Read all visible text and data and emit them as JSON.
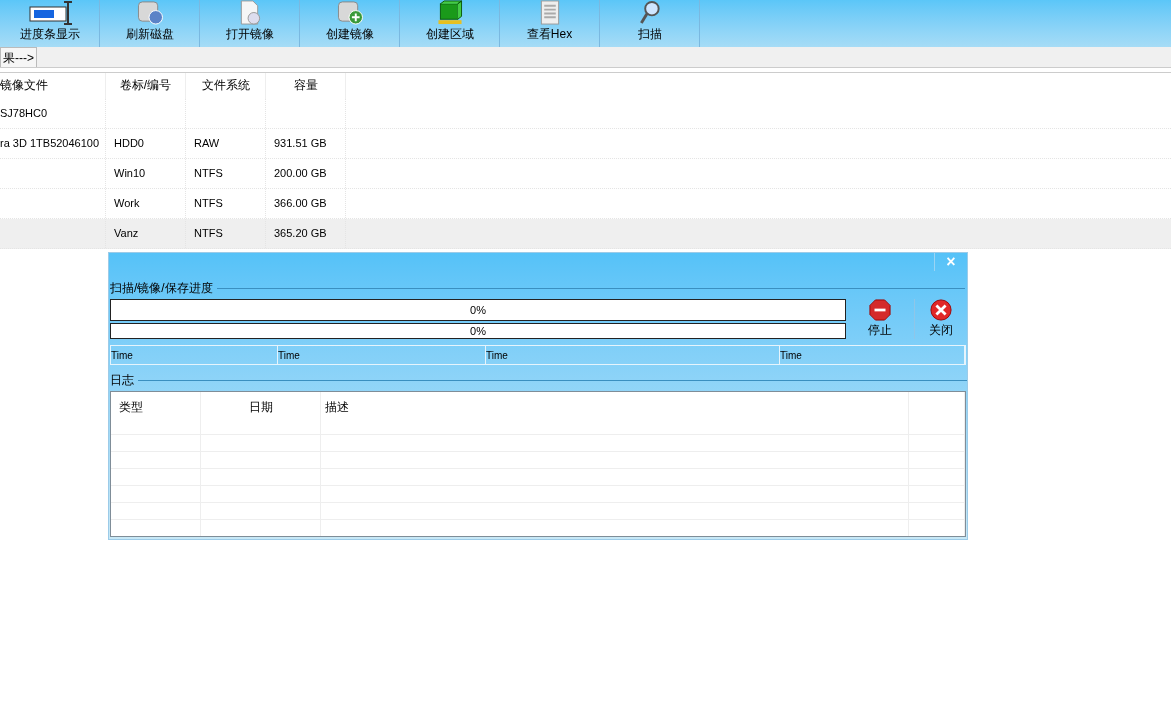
{
  "toolbar": [
    {
      "label": "进度条显示",
      "kind": "progress"
    },
    {
      "label": "刷新磁盘",
      "kind": "refresh"
    },
    {
      "label": "打开镜像",
      "kind": "open"
    },
    {
      "label": "创建镜像",
      "kind": "create"
    },
    {
      "label": "创建区域",
      "kind": "region"
    },
    {
      "label": "查看Hex",
      "kind": "hex"
    },
    {
      "label": "扫描",
      "kind": "scan"
    }
  ],
  "result_tab": {
    "label": "果--->"
  },
  "table": {
    "columns": [
      "镜像文件",
      "卷标/编号",
      "文件系统",
      "容量"
    ],
    "rows": [
      {
        "cells": [
          "SJ78HC0",
          "",
          "",
          ""
        ],
        "selected": false
      },
      {
        "cells": [
          "ra 3D 1TB52046100",
          "HDD0",
          "RAW",
          "931.51 GB"
        ],
        "selected": false
      },
      {
        "cells": [
          "",
          "Win10",
          "NTFS",
          "200.00 GB"
        ],
        "selected": false
      },
      {
        "cells": [
          "",
          "Work",
          "NTFS",
          "366.00 GB"
        ],
        "selected": false
      },
      {
        "cells": [
          "",
          "Vanz",
          "NTFS",
          "365.20 GB"
        ],
        "selected": true
      }
    ]
  },
  "dialog": {
    "close": "×",
    "progress_group": "扫描/镜像/保存进度",
    "bars": [
      {
        "level": 0,
        "reading": "0%"
      },
      {
        "level": 0,
        "reading": "0%"
      }
    ],
    "buttons": [
      {
        "label": "停止",
        "kind": "stop"
      },
      {
        "label": "关闭",
        "kind": "close"
      }
    ],
    "times": [
      "Time",
      "Time",
      "Time",
      "Time"
    ],
    "log_group": "日志",
    "log_columns": [
      "类型",
      "日期",
      "描述",
      ""
    ]
  }
}
